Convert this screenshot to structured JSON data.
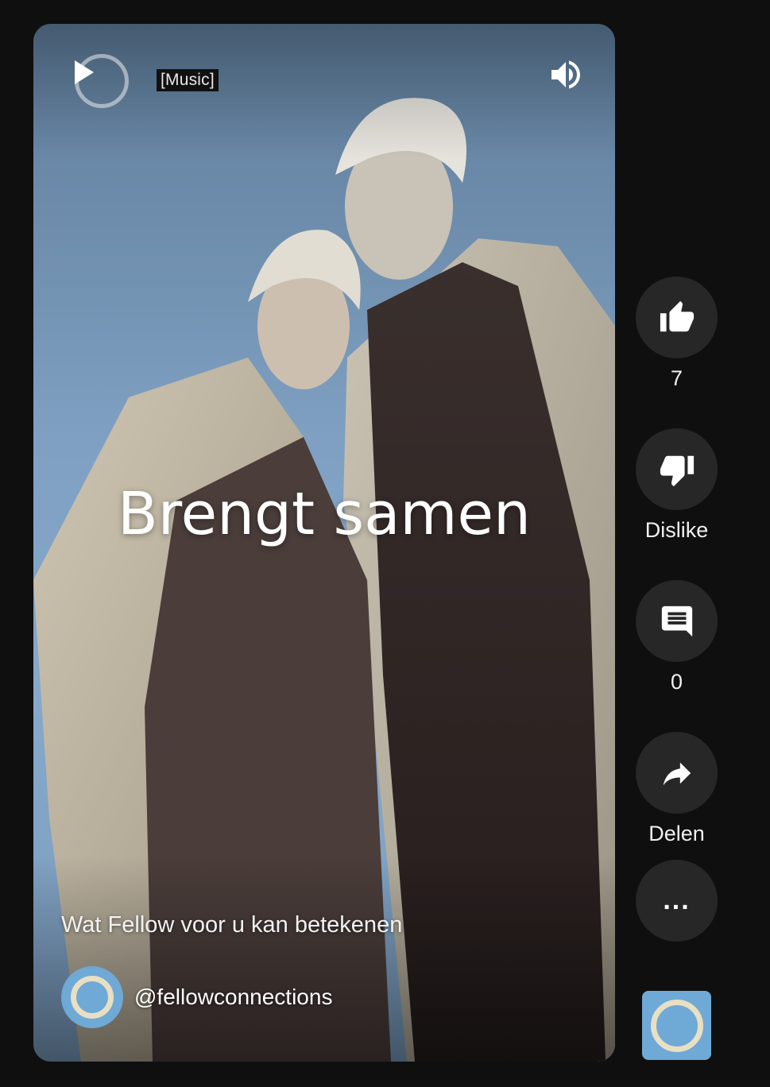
{
  "player": {
    "caption_tag": "[Music]",
    "headline": "Brengt samen",
    "description": "Wat Fellow voor u kan betekenen",
    "channel_handle": "@fellowconnections"
  },
  "actions": {
    "like_count": "7",
    "dislike_label": "Dislike",
    "comment_count": "0",
    "share_label": "Delen",
    "more_label": "..."
  },
  "colors": {
    "background": "#0f0f0f",
    "action_button": "#272727",
    "avatar_blue": "#6fa9d6",
    "avatar_ring": "#e9dfc3"
  },
  "icons": [
    "play-icon",
    "volume-icon",
    "thumbs-up-icon",
    "thumbs-down-icon",
    "comment-icon",
    "share-icon",
    "more-icon"
  ]
}
